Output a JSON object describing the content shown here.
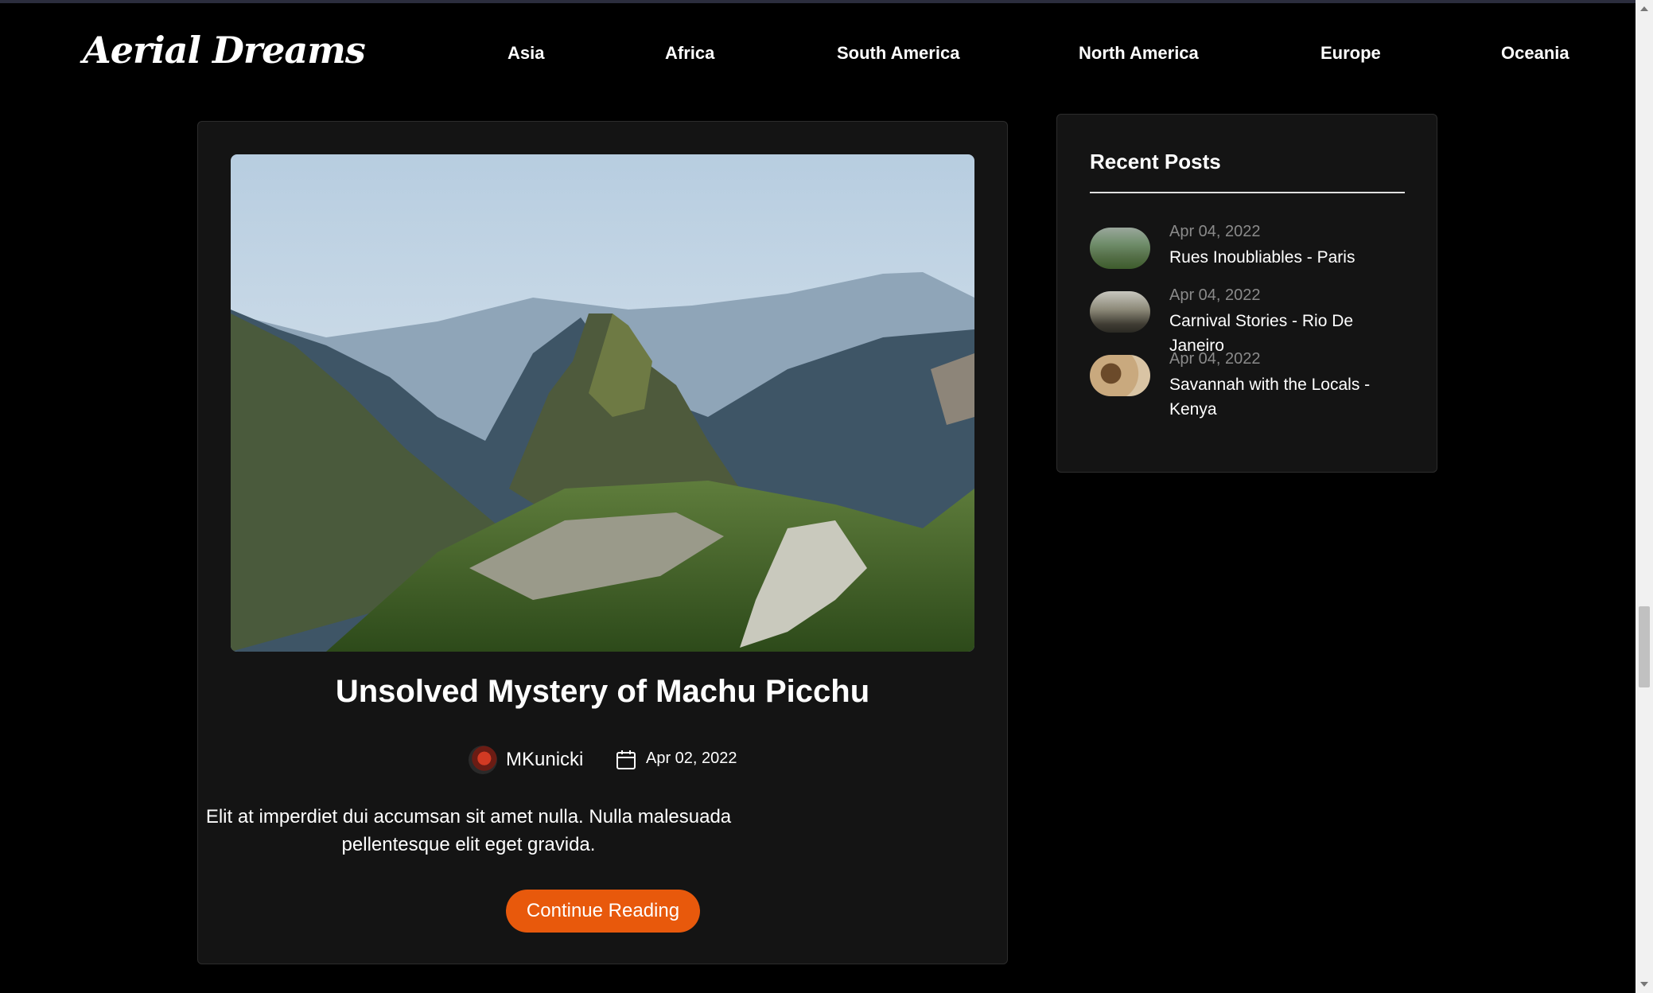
{
  "site": {
    "logo": "Aerial Dreams"
  },
  "nav": {
    "items": [
      "Asia",
      "Africa",
      "South America",
      "North America",
      "Europe",
      "Oceania"
    ]
  },
  "post": {
    "title": "Unsolved Mystery of Machu Picchu",
    "author": "MKunicki",
    "date": "Apr 02, 2022",
    "excerpt": "Elit at imperdiet dui accumsan sit amet nulla. Nulla malesuada pellentesque elit eget gravida.",
    "button_label": "Continue Reading",
    "image_icon": "mountain-landscape-image"
  },
  "sidebar": {
    "title": "Recent Posts",
    "items": [
      {
        "date": "Apr 04, 2022",
        "title": "Rues Inoubliables - Paris"
      },
      {
        "date": "Apr 04, 2022",
        "title": "Carnival Stories - Rio De Janeiro"
      },
      {
        "date": "Apr 04, 2022",
        "title": "Savannah with the Locals - Kenya"
      }
    ]
  },
  "colors": {
    "accent": "#e8590c",
    "background": "#000000",
    "card": "#141414",
    "muted_text": "#8a8a8a"
  }
}
